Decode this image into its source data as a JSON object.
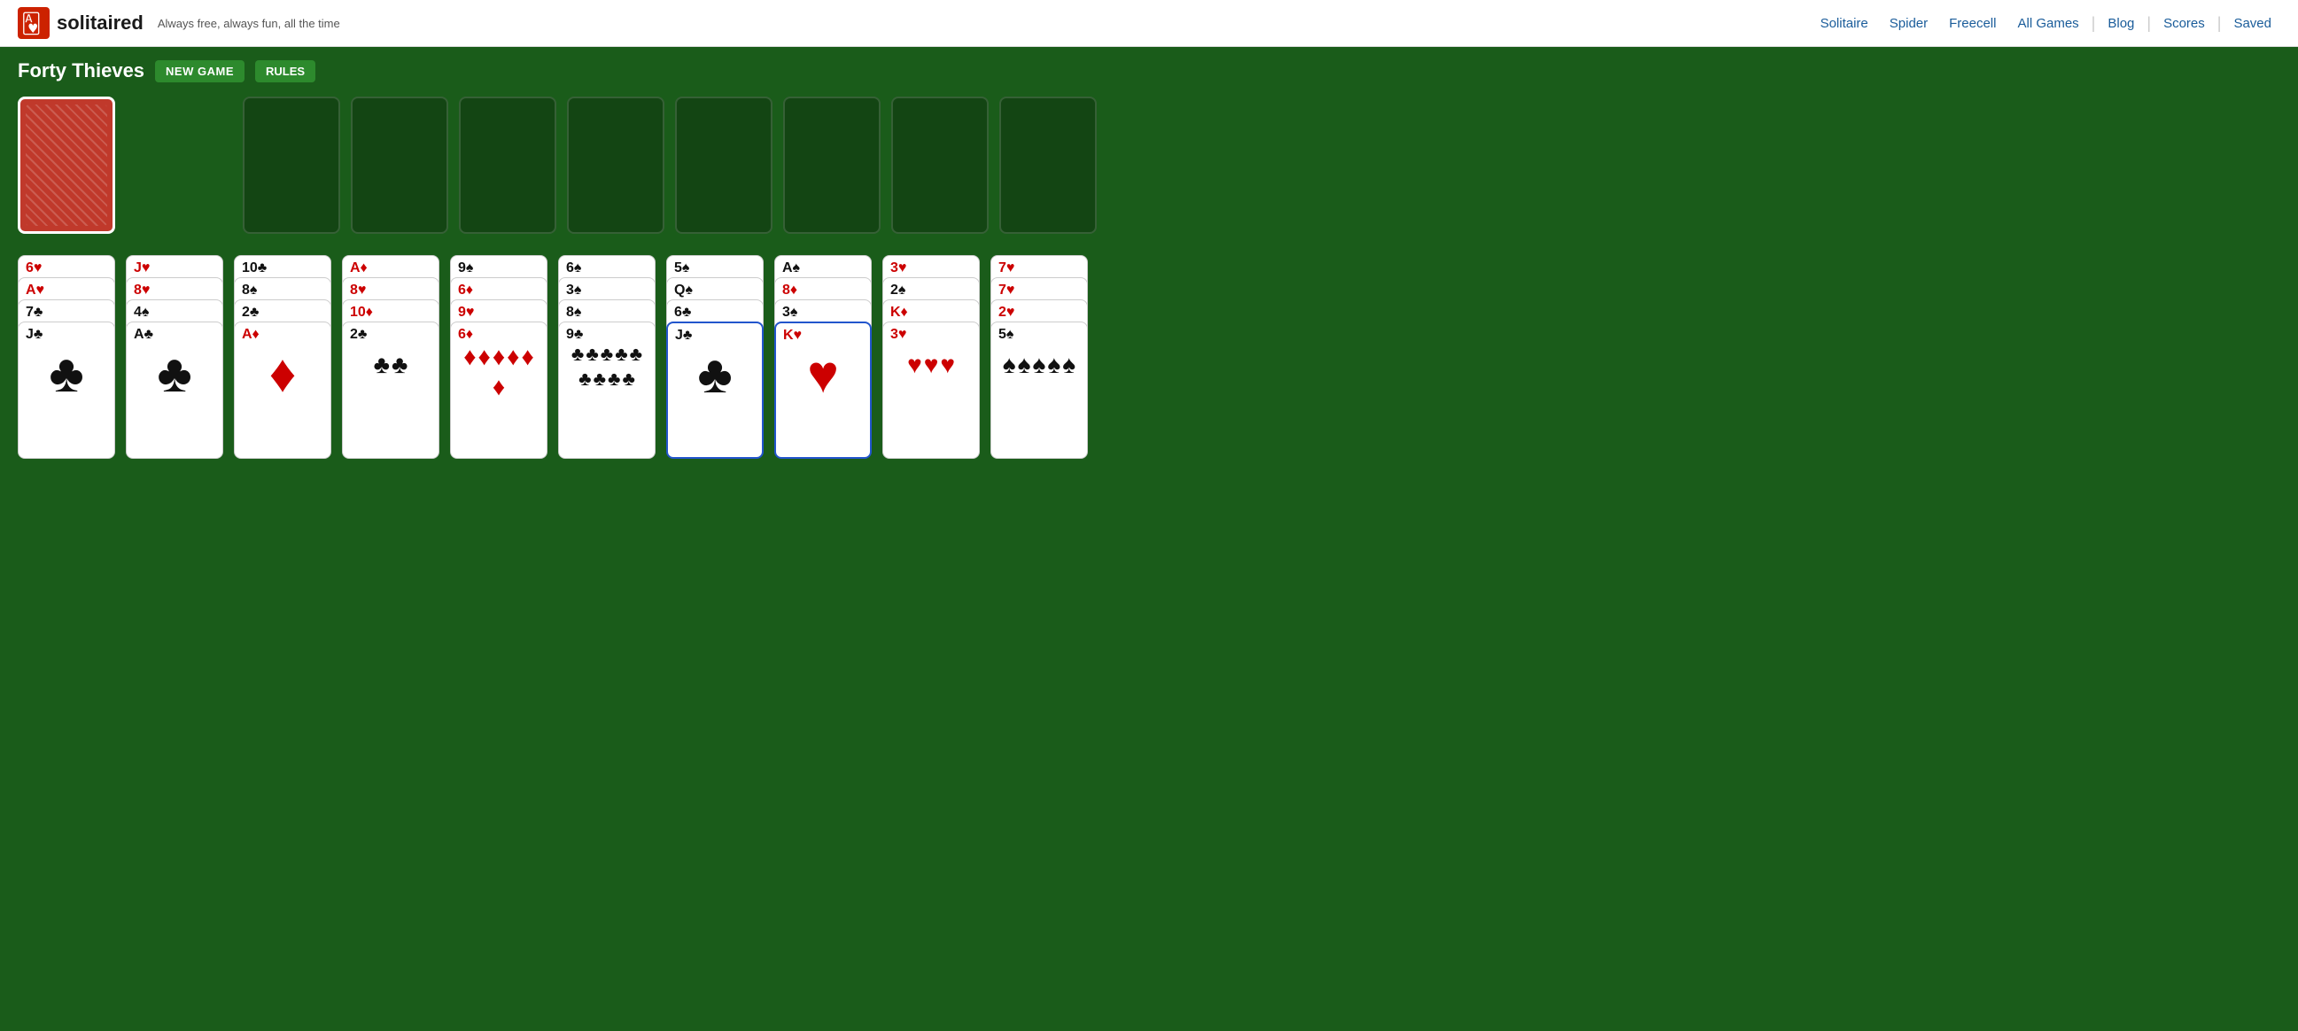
{
  "header": {
    "logo_text": "solitaired",
    "tagline": "Always free, always fun, all the time",
    "nav_links": [
      "Solitaire",
      "Spider",
      "Freecell",
      "All Games",
      "Blog",
      "Scores",
      "Saved"
    ]
  },
  "game": {
    "title": "Forty Thieves",
    "btn_new_game": "NEW GAME",
    "btn_rules": "RULES"
  },
  "columns": [
    {
      "id": 0,
      "cards": [
        {
          "rank": "6",
          "suit": "♥",
          "color": "red",
          "label": "6♥"
        },
        {
          "rank": "A",
          "suit": "♥",
          "color": "red",
          "label": "A♥"
        },
        {
          "rank": "7",
          "suit": "♣",
          "color": "black",
          "label": "7♣"
        },
        {
          "rank": "J",
          "suit": "♣",
          "color": "black",
          "label": "J♣",
          "last": true
        }
      ]
    },
    {
      "id": 1,
      "cards": [
        {
          "rank": "J",
          "suit": "♥",
          "color": "red",
          "label": "J♥"
        },
        {
          "rank": "8",
          "suit": "♥",
          "color": "red",
          "label": "8♥"
        },
        {
          "rank": "4",
          "suit": "♠",
          "color": "black",
          "label": "4♠"
        },
        {
          "rank": "A",
          "suit": "♣",
          "color": "black",
          "label": "A♣",
          "last": true
        }
      ]
    },
    {
      "id": 2,
      "cards": [
        {
          "rank": "10",
          "suit": "♣",
          "color": "black",
          "label": "10♣"
        },
        {
          "rank": "8",
          "suit": "♠",
          "color": "black",
          "label": "8♠"
        },
        {
          "rank": "2",
          "suit": "♣",
          "color": "black",
          "label": "2♣"
        },
        {
          "rank": "A",
          "suit": "♦",
          "color": "red",
          "label": "A♦",
          "last": true
        }
      ]
    },
    {
      "id": 3,
      "cards": [
        {
          "rank": "A",
          "suit": "♦",
          "color": "red",
          "label": "A♦"
        },
        {
          "rank": "8",
          "suit": "♥",
          "color": "red",
          "label": "8♥"
        },
        {
          "rank": "10",
          "suit": "♦",
          "color": "red",
          "label": "10♦"
        },
        {
          "rank": "2",
          "suit": "♣",
          "color": "black",
          "label": "2♣",
          "last": true
        }
      ]
    },
    {
      "id": 4,
      "cards": [
        {
          "rank": "9",
          "suit": "♠",
          "color": "black",
          "label": "9♠"
        },
        {
          "rank": "6",
          "suit": "♦",
          "color": "red",
          "label": "6♦"
        },
        {
          "rank": "9",
          "suit": "♥",
          "color": "red",
          "label": "9♥"
        },
        {
          "rank": "6",
          "suit": "♦",
          "color": "red",
          "label": "6♦",
          "last": true
        }
      ]
    },
    {
      "id": 5,
      "cards": [
        {
          "rank": "6",
          "suit": "♠",
          "color": "black",
          "label": "6♠"
        },
        {
          "rank": "3",
          "suit": "♠",
          "color": "black",
          "label": "3♠"
        },
        {
          "rank": "8",
          "suit": "♠",
          "color": "black",
          "label": "8♠"
        },
        {
          "rank": "9",
          "suit": "♣",
          "color": "black",
          "label": "9♣",
          "last": true
        }
      ]
    },
    {
      "id": 6,
      "cards": [
        {
          "rank": "5",
          "suit": "♠",
          "color": "black",
          "label": "5♠"
        },
        {
          "rank": "Q",
          "suit": "♠",
          "color": "black",
          "label": "Q♠"
        },
        {
          "rank": "6",
          "suit": "♣",
          "color": "black",
          "label": "6♣"
        },
        {
          "rank": "J",
          "suit": "♣",
          "color": "black",
          "label": "J♣",
          "last": true,
          "selected": true
        }
      ]
    },
    {
      "id": 7,
      "cards": [
        {
          "rank": "A",
          "suit": "♠",
          "color": "black",
          "label": "A♠"
        },
        {
          "rank": "8",
          "suit": "♦",
          "color": "red",
          "label": "8♦"
        },
        {
          "rank": "3",
          "suit": "♠",
          "color": "black",
          "label": "3♠"
        },
        {
          "rank": "K",
          "suit": "♥",
          "color": "red",
          "label": "K♥",
          "last": true,
          "selected": true
        }
      ]
    },
    {
      "id": 8,
      "cards": [
        {
          "rank": "3",
          "suit": "♥",
          "color": "red",
          "label": "3♥"
        },
        {
          "rank": "2",
          "suit": "♠",
          "color": "black",
          "label": "2♠"
        },
        {
          "rank": "K",
          "suit": "♦",
          "color": "red",
          "label": "K♦"
        },
        {
          "rank": "3",
          "suit": "♥",
          "color": "red",
          "label": "3♥",
          "last": true
        }
      ]
    },
    {
      "id": 9,
      "cards": [
        {
          "rank": "7",
          "suit": "♥",
          "color": "red",
          "label": "7♥"
        },
        {
          "rank": "7",
          "suit": "♥",
          "color": "red",
          "label": "7♥"
        },
        {
          "rank": "2",
          "suit": "♥",
          "color": "red",
          "label": "2♥"
        },
        {
          "rank": "5",
          "suit": "♠",
          "color": "black",
          "label": "5♠",
          "last": true
        }
      ]
    }
  ],
  "foundations": [
    {
      "id": 0
    },
    {
      "id": 1
    },
    {
      "id": 2
    },
    {
      "id": 3
    },
    {
      "id": 4
    },
    {
      "id": 5
    },
    {
      "id": 6
    },
    {
      "id": 7
    }
  ]
}
